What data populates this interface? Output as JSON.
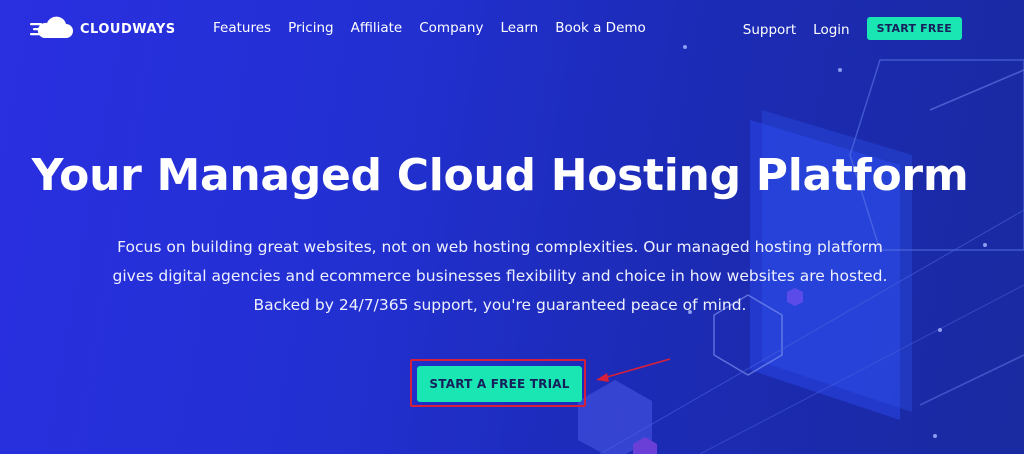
{
  "brand": {
    "name": "CLOUDWAYS",
    "logo_icon": "cloud-icon"
  },
  "nav": {
    "links": [
      "Features",
      "Pricing",
      "Affiliate",
      "Company",
      "Learn",
      "Book a Demo"
    ],
    "support": "Support",
    "login": "Login",
    "start_free": "START FREE"
  },
  "hero": {
    "title": "Your Managed Cloud Hosting Platform",
    "subtitle": "Focus on building great websites, not on web hosting complexities. Our managed hosting platform gives digital agencies and ecommerce businesses flexibility and choice in how websites are hosted. Backed by 24/7/365 support, you're guaranteed peace of mind.",
    "cta": "START A FREE TRIAL"
  },
  "colors": {
    "accent": "#19e6b3",
    "highlight_frame": "#d6203a",
    "background": "#2230d2"
  }
}
